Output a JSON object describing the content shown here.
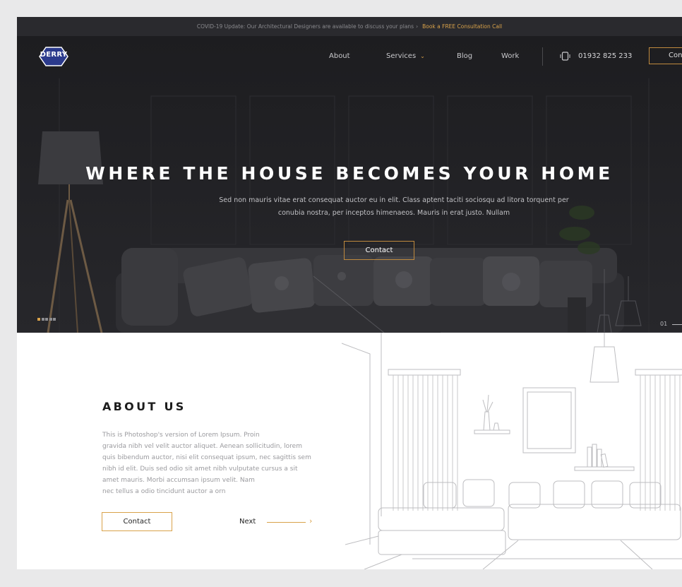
{
  "announcement": {
    "text": "COVID-19 Update: Our Architectural Designers are available to discuss your plans",
    "separator": "›",
    "cta": "Book a FREE Consultation Call"
  },
  "logo": {
    "text": "DERRY",
    "name": "logo"
  },
  "nav": {
    "about": "About",
    "services": "Services",
    "blog": "Blog",
    "work": "Work",
    "phone": "01932 825 233",
    "contact_btn": "Con"
  },
  "hero": {
    "title": "WHERE THE HOUSE BECOMES YOUR HOME",
    "subtitle_line1": "Sed non  mauris vitae erat consequat auctor eu in elit. Class aptent taciti sociosqu ad litora torquent per",
    "subtitle_line2": "conubia nostra, per inceptos himenaeos. Mauris in erat justo. Nullam",
    "button": "Contact",
    "slide_count": 5,
    "active_slide": 1,
    "slide_number": "01"
  },
  "about": {
    "title": "ABOUT US",
    "text_lines": [
      "This is Photoshop's version  of Lorem Ipsum. Proin",
      "gravida nibh vel velit auctor aliquet. Aenean sollicitudin, lorem",
      "quis bibendum auctor, nisi elit consequat ipsum, nec sagittis sem",
      "nibh id elit. Duis sed odio sit amet nibh vulputate cursus a sit",
      "amet mauris. Morbi accumsan ipsum velit. Nam",
      "nec tellus a odio tincidunt auctor a orn"
    ],
    "button": "Contact",
    "next": "Next",
    "next_arrow": "›"
  },
  "colors": {
    "accent": "#d9a24a",
    "hero_bg": "#1f1f22",
    "topbar_bg": "#2a2a2e",
    "page_bg": "#e9e9ea"
  },
  "icons": [
    "logo-badge-icon",
    "chevron-down-icon",
    "phone-icon",
    "arrow-right-icon"
  ]
}
